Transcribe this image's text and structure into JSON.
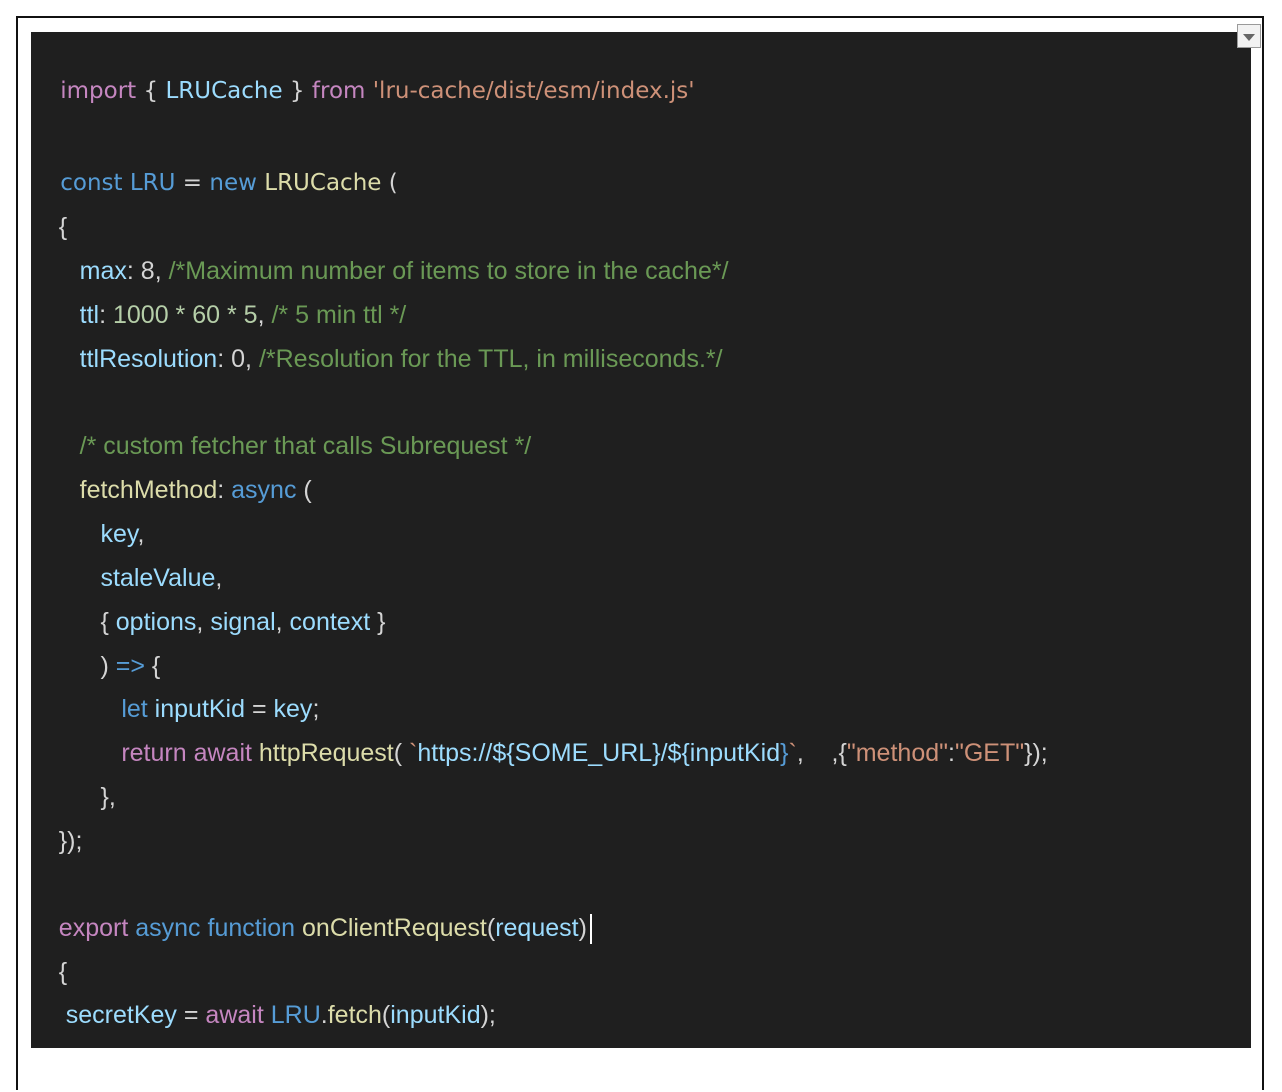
{
  "editor": {
    "lines": {
      "l1": {
        "kw": "import",
        "b1": " { ",
        "name": "LRUCache",
        "b2": " } ",
        "from": "from",
        "sp": " ",
        "path": "'lru-cache/dist/esm/index.js'"
      },
      "l3": {
        "const": "const",
        "sp1": " ",
        "name": "LRU",
        "eq": " = ",
        "new": "new",
        "sp2": " ",
        "cls": "LRUCache",
        "paren": " ("
      },
      "l4": {
        "brace": "{"
      },
      "l5": {
        "indent": "   ",
        "key": "max",
        "colon": ": ",
        "val": "8",
        "comma": ", ",
        "comment": "/*Maximum number of items to store in the cache*/"
      },
      "l6": {
        "indent": "   ",
        "key": "ttl",
        "colon": ": ",
        "val": "1000 * 60 * 5",
        "comma": ", ",
        "comment": "/* 5 min ttl */"
      },
      "l7": {
        "indent": "   ",
        "key": "ttlResolution",
        "colon": ": ",
        "val": "0",
        "comma": ", ",
        "comment": "/*Resolution for the TTL, in milliseconds.*/"
      },
      "l9": {
        "indent": "   ",
        "comment": "/* custom fetcher that calls Subrequest */"
      },
      "l10": {
        "indent": "   ",
        "key": "fetchMethod",
        "colon": ": ",
        "async": "async",
        "paren": " ("
      },
      "l11": {
        "indent": "      ",
        "name": "key",
        "comma": ","
      },
      "l12": {
        "indent": "      ",
        "name": "staleValue",
        "comma": ","
      },
      "l13": {
        "indent": "      ",
        "b1": "{ ",
        "opt": "options",
        "c1": ", ",
        "sig": "signal",
        "c2": ", ",
        "ctx": "context",
        "b2": " }"
      },
      "l14": {
        "indent": "      ",
        "paren": ") ",
        "arrow": "=>",
        "brace": " {"
      },
      "l15": {
        "indent": "         ",
        "let": "let",
        "sp": " ",
        "name": "inputKid",
        "eq": " = ",
        "key": "key",
        "semi": ";"
      },
      "l16": {
        "indent": "         ",
        "ret": "return",
        "sp1": " ",
        "await": "await",
        "sp2": " ",
        "fn": "httpRequest",
        "open": "( ",
        "tick1": "`",
        "url1": "https://",
        "t1": "${",
        "v1": "SOME_URL",
        "t2": "}",
        "slash": "/",
        "t3": "${",
        "v2": "inputKid",
        "t4": "}",
        "tick2": "`",
        "comma": ",    ,{",
        "k": "\"method\"",
        "colon": ":",
        "v": "\"GET\"",
        "close": "});"
      },
      "l17": {
        "indent": "      ",
        "text": "},"
      },
      "l18": {
        "text": "});"
      },
      "l20": {
        "export": "export",
        "sp1": " ",
        "async": "async",
        "sp2": " ",
        "function": "function",
        "sp3": " ",
        "fn": "onClientRequest",
        "open": "(",
        "param": "request",
        "close": ")"
      },
      "l21": {
        "brace": "{"
      },
      "l22": {
        "indent": " ",
        "name": "secretKey",
        "eq": " = ",
        "await": "await",
        "sp": " ",
        "obj": "LRU",
        "dot": ".",
        "method": "fetch",
        "open": "(",
        "arg": "inputKid",
        "close": ");"
      },
      "l23": {
        "brace": "}"
      }
    }
  },
  "colors": {
    "background": "#1f1f1f",
    "keyword_control": "#c586c0",
    "keyword": "#569cd6",
    "variable": "#9cdcfe",
    "function": "#dcdcaa",
    "string": "#ce9178",
    "number": "#b5cea8",
    "comment": "#6a9955"
  },
  "icons": {
    "dropdown": "chevron-down-icon"
  }
}
